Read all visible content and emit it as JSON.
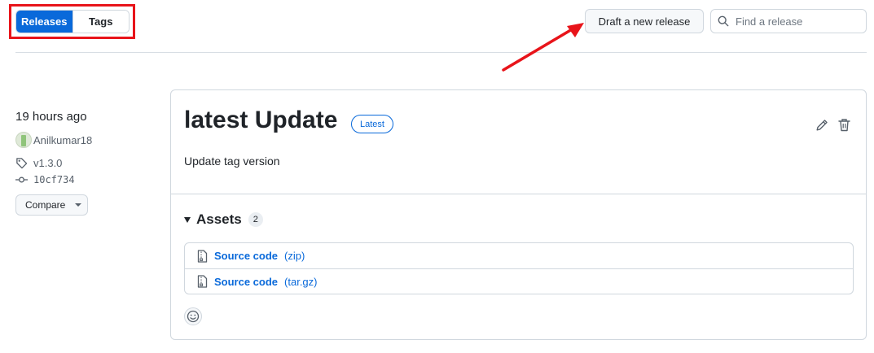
{
  "tabs": [
    {
      "label": "Releases",
      "active": true
    },
    {
      "label": "Tags",
      "active": false
    }
  ],
  "toolbar": {
    "draft_label": "Draft a new release",
    "search_placeholder": "Find a release"
  },
  "release": {
    "time_ago": "19 hours ago",
    "author": "Anilkumar18",
    "tag": "v1.3.0",
    "commit": "10cf734",
    "compare_label": "Compare",
    "title": "latest Update",
    "badge": "Latest",
    "body": "Update tag version",
    "assets_label": "Assets",
    "assets_count": "2",
    "assets": [
      {
        "name": "Source code",
        "format": "(zip)"
      },
      {
        "name": "Source code",
        "format": "(tar.gz)"
      }
    ]
  },
  "colors": {
    "accent": "#0969da",
    "annotation": "#e8141a",
    "border": "#d0d7de",
    "text": "#1f2328",
    "muted": "#57606a"
  },
  "icons": [
    "search-icon",
    "tag-icon",
    "commit-icon",
    "pencil-icon",
    "trash-icon",
    "file-zip-icon",
    "smiley-icon",
    "caret-down-icon",
    "avatar"
  ]
}
